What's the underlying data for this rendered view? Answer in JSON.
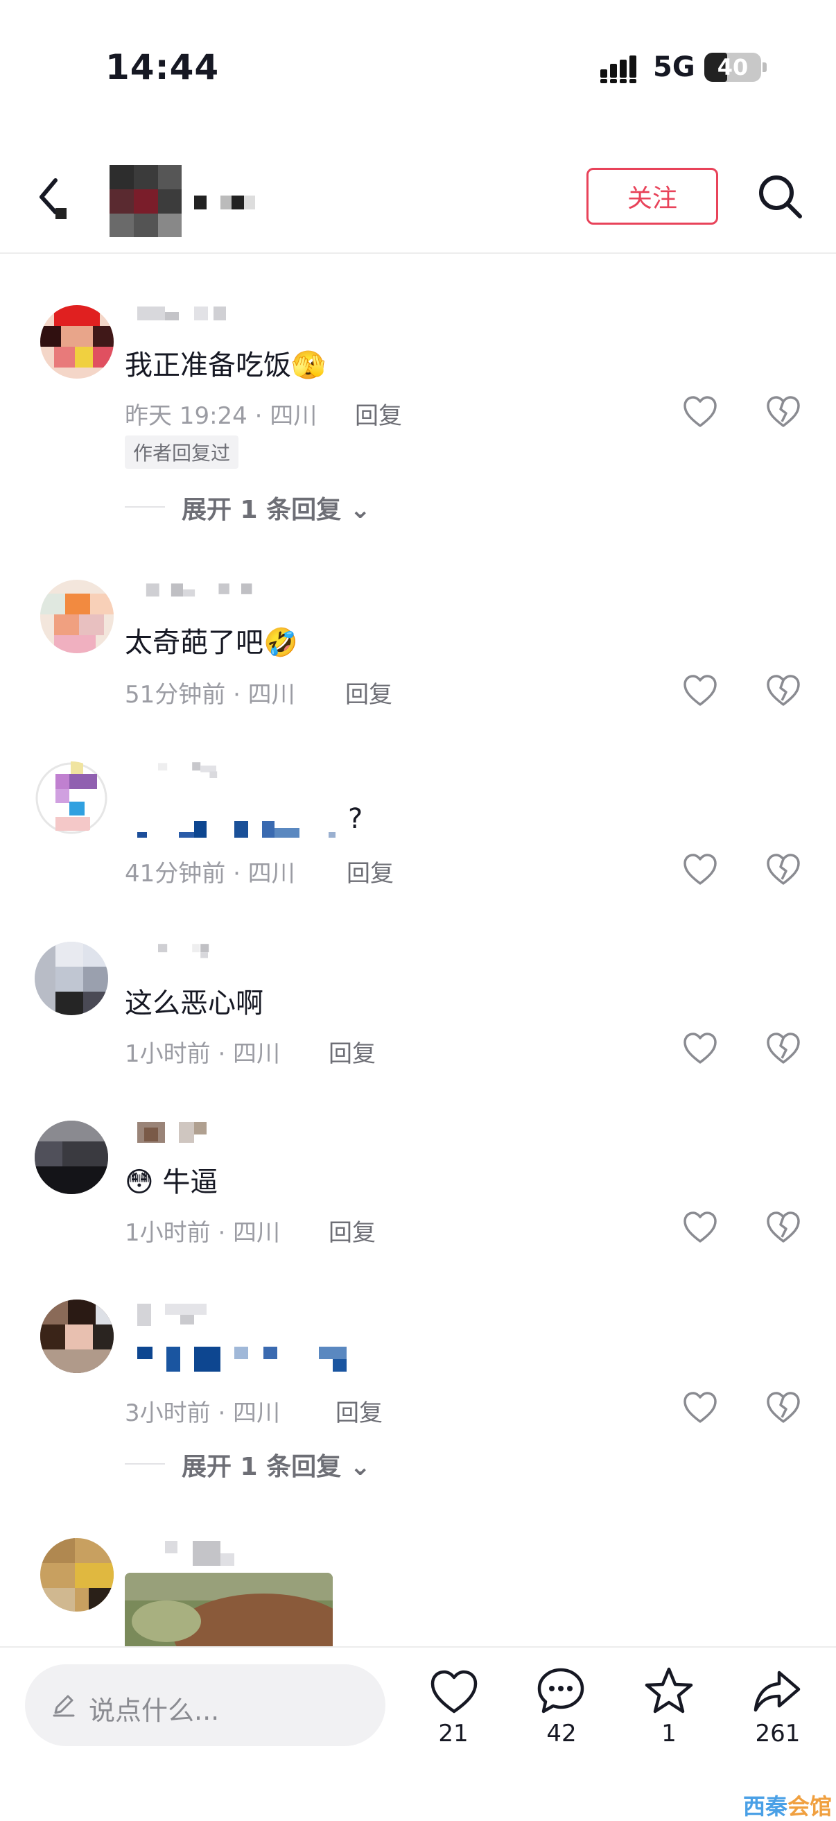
{
  "status_bar": {
    "time": "14:44",
    "network": "5G",
    "battery": "40",
    "battery_level": 0.4
  },
  "header": {
    "follow_label": "关注",
    "back_icon": "back-arrow-icon",
    "search_icon": "search-icon"
  },
  "comments": [
    {
      "text": "我正准备吃饭",
      "emoji": "🫣",
      "meta": "昨天 19:24 · 四川",
      "reply": "回复",
      "tag": "作者回复过",
      "expand": "展开 1 条回复"
    },
    {
      "text": "太奇葩了吧",
      "emoji": "🤣",
      "meta": "51分钟前 · 四川",
      "reply": "回复"
    },
    {
      "text": "?",
      "meta": "41分钟前 · 四川",
      "reply": "回复"
    },
    {
      "text": "这么恶心啊",
      "meta": "1小时前 · 四川",
      "reply": "回复"
    },
    {
      "text": "牛逼",
      "emoji": "😳",
      "meta": "1小时前 · 四川",
      "reply": "回复"
    },
    {
      "text": "",
      "meta": "3小时前 · 四川",
      "reply": "回复",
      "expand": "展开 1 条回复"
    }
  ],
  "bottom_bar": {
    "input_placeholder": "说点什么...",
    "likes": "21",
    "comments": "42",
    "favorites": "1",
    "shares": "261"
  },
  "watermark": {
    "part1": "西秦",
    "part2": "会馆"
  },
  "colors": {
    "accent": "#e8435a",
    "text": "#161823",
    "meta": "#9b9ca3"
  }
}
